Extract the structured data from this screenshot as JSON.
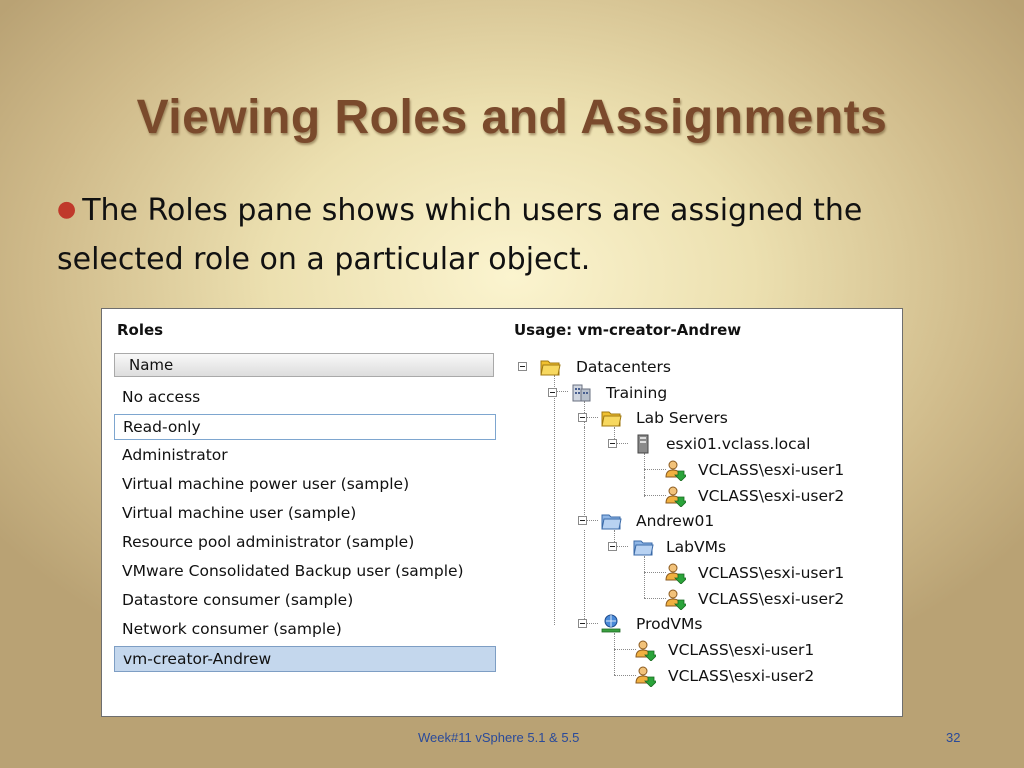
{
  "slide": {
    "title": "Viewing Roles and Assignments",
    "bullet": "The Roles pane shows which users are assigned the selected role on a particular object.",
    "footer": "Week#11  vSphere 5.1 & 5.5",
    "page_number": "32"
  },
  "roles_pane": {
    "title": "Roles",
    "column_header": "Name",
    "items": [
      "No access",
      "Read-only",
      "Administrator",
      "Virtual machine power user (sample)",
      "Virtual machine user (sample)",
      "Resource pool administrator (sample)",
      "VMware Consolidated Backup user (sample)",
      "Datastore consumer (sample)",
      "Network consumer (sample)",
      "vm-creator-Andrew"
    ],
    "focused_item": "Read-only",
    "selected_item": "vm-creator-Andrew"
  },
  "usage_pane": {
    "title": "Usage: vm-creator-Andrew",
    "tree": [
      {
        "label": "Datacenters",
        "icon": "folder-icon"
      },
      {
        "label": "Training",
        "icon": "datacenter-icon"
      },
      {
        "label": "Lab Servers",
        "icon": "folder-icon"
      },
      {
        "label": "esxi01.vclass.local",
        "icon": "host-icon"
      },
      {
        "label": "VCLASS\\esxi-user1",
        "icon": "user-icon"
      },
      {
        "label": "VCLASS\\esxi-user2",
        "icon": "user-icon"
      },
      {
        "label": "Andrew01",
        "icon": "vm-folder-icon"
      },
      {
        "label": "LabVMs",
        "icon": "vm-folder-icon"
      },
      {
        "label": "VCLASS\\esxi-user1",
        "icon": "user-icon"
      },
      {
        "label": "VCLASS\\esxi-user2",
        "icon": "user-icon"
      },
      {
        "label": "ProdVMs",
        "icon": "resource-pool-icon"
      },
      {
        "label": "VCLASS\\esxi-user1",
        "icon": "user-icon"
      },
      {
        "label": "VCLASS\\esxi-user2",
        "icon": "user-icon"
      }
    ]
  },
  "colors": {
    "title": "#7a4a2c",
    "bullet": "#c0392b",
    "selection": "#c4d7ed",
    "footer": "#2a4a9a"
  }
}
